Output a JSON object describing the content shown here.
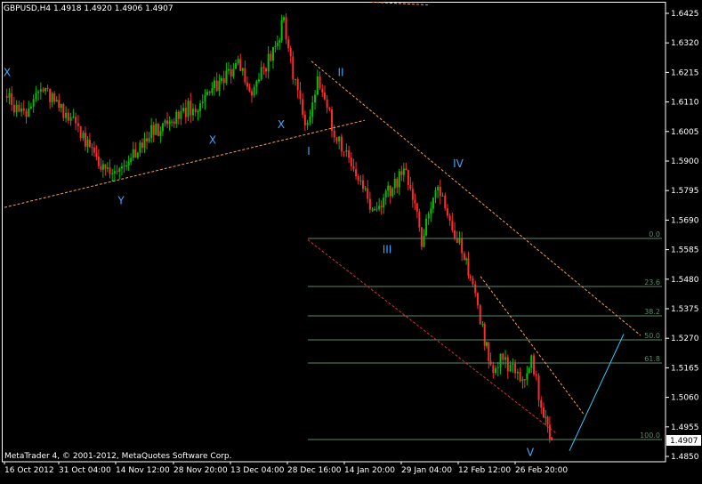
{
  "header": {
    "symbol_line": "GBPUSD,H4  1.4918 1.4920 1.4906 1.4907"
  },
  "footer": {
    "copyright": "MetaTrader 4, © 2001-2012, MetaQuotes Software Corp."
  },
  "colors": {
    "background": "#000000",
    "axis": "#ffffff",
    "bull_candle": "#00c000",
    "bear_candle": "#ff2a2a",
    "price_tag_bg": "#ffffff",
    "trendline": "#ffa040",
    "fib_lines": "#5a8a6a",
    "wave_labels": "#3fa8ff",
    "projection": "#33ccff",
    "channel_red": "#e03020"
  },
  "chart_data": {
    "type": "candlestick",
    "symbol": "GBPUSD",
    "timeframe": "H4",
    "ohlc": {
      "open": 1.4918,
      "high": 1.492,
      "low": 1.4906,
      "close": 1.4907
    },
    "last_price_tag": "1.4907",
    "ylim": [
      1.482,
      1.646
    ],
    "y_ticks": [
      "1.6425",
      "1.6320",
      "1.6215",
      "1.6110",
      "1.6005",
      "1.5900",
      "1.5795",
      "1.5690",
      "1.5585",
      "1.5480",
      "1.5375",
      "1.5270",
      "1.5165",
      "1.5060",
      "1.4955",
      "1.4850"
    ],
    "x_ticks": [
      "16 Oct 2012",
      "31 Oct 04:00",
      "14 Nov 12:00",
      "28 Nov 20:00",
      "13 Dec 04:00",
      "28 Dec 16:00",
      "14 Jan 20:00",
      "29 Jan 04:00",
      "12 Feb 12:00",
      "26 Feb 20:00"
    ],
    "price_path": [
      [
        "16 Oct 2012",
        1.613
      ],
      [
        "21 Oct",
        1.606
      ],
      [
        "26 Oct",
        1.615
      ],
      [
        "31 Oct 04:00",
        1.608
      ],
      [
        "5 Nov",
        1.598
      ],
      [
        "11 Nov",
        1.585
      ],
      [
        "14 Nov 12:00",
        1.588
      ],
      [
        "20 Nov",
        1.598
      ],
      [
        "28 Nov 20:00",
        1.608
      ],
      [
        "3 Dec",
        1.61
      ],
      [
        "13 Dec 04:00",
        1.625
      ],
      [
        "17 Dec",
        1.615
      ],
      [
        "23 Dec",
        1.628
      ],
      [
        "26 Dec",
        1.64
      ],
      [
        "28 Dec 16:00",
        1.622
      ],
      [
        "2 Jan",
        1.602
      ],
      [
        "5 Jan",
        1.618
      ],
      [
        "10 Jan",
        1.601
      ],
      [
        "14 Jan 20:00",
        1.587
      ],
      [
        "21 Jan",
        1.572
      ],
      [
        "29 Jan 04:00",
        1.588
      ],
      [
        "2 Feb",
        1.562
      ],
      [
        "6 Feb",
        1.582
      ],
      [
        "12 Feb 12:00",
        1.556
      ],
      [
        "14 Feb",
        1.548
      ],
      [
        "17 Feb",
        1.53
      ],
      [
        "19 Feb",
        1.516
      ],
      [
        "22 Feb",
        1.52
      ],
      [
        "26 Feb 20:00",
        1.51
      ],
      [
        "1 Mar",
        1.518
      ],
      [
        "4 Mar",
        1.5
      ],
      [
        "6 Mar",
        1.4907
      ]
    ],
    "fibonacci_levels": [
      "0.0",
      "23.6",
      "38.2",
      "50.0",
      "61.8",
      "100.0"
    ],
    "wave_labels": [
      "X",
      "Y",
      "X",
      "X",
      "I",
      "II",
      "III",
      "IV",
      "V"
    ],
    "annotations": [
      "trendline",
      "downtrend channel",
      "projection line"
    ]
  }
}
